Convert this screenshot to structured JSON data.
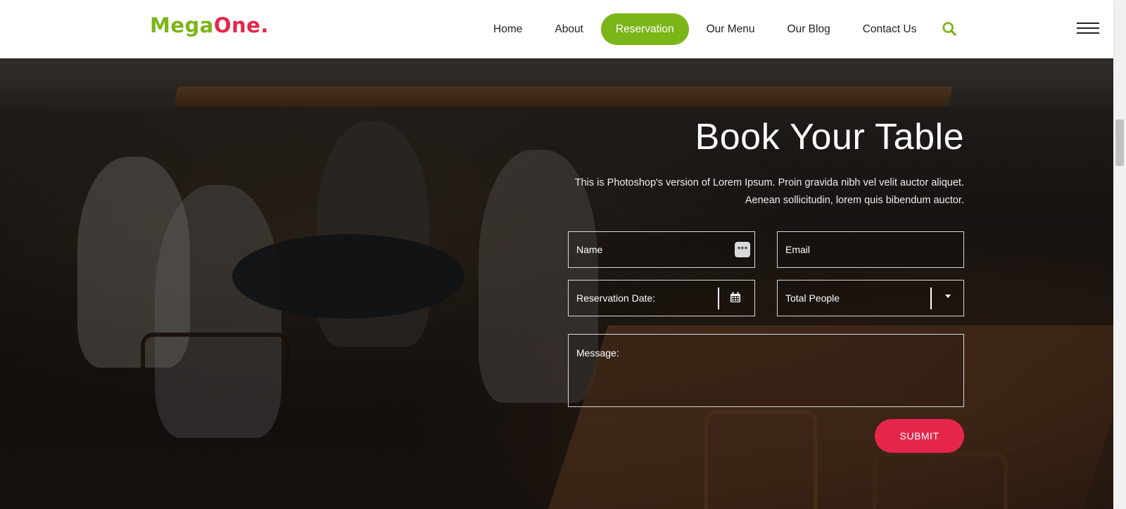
{
  "header": {
    "logo": {
      "part1": "MegaOne",
      "part2": "."
    },
    "nav": [
      {
        "label": "Home",
        "active": false
      },
      {
        "label": "About",
        "active": false
      },
      {
        "label": "Reservation",
        "active": true
      },
      {
        "label": "Our Menu",
        "active": false
      },
      {
        "label": "Our Blog",
        "active": false
      },
      {
        "label": "Contact Us",
        "active": false
      }
    ],
    "icons": {
      "search": "search-icon",
      "menu": "hamburger-menu-icon"
    }
  },
  "hero": {
    "title": "Book Your Table",
    "subtitle_line1": "This is Photoshop's version of Lorem Ipsum. Proin gravida nibh vel velit auctor aliquet.",
    "subtitle_line2": "Aenean sollicitudin, lorem quis bibendum auctor."
  },
  "form": {
    "name_placeholder": "Name",
    "email_placeholder": "Email",
    "date_placeholder": "Reservation Date:",
    "people_placeholder": "Total People",
    "message_placeholder": "Message:",
    "submit_label": "SUBMIT"
  },
  "colors": {
    "brand_green": "#7cb518",
    "brand_red": "#e5264a"
  }
}
